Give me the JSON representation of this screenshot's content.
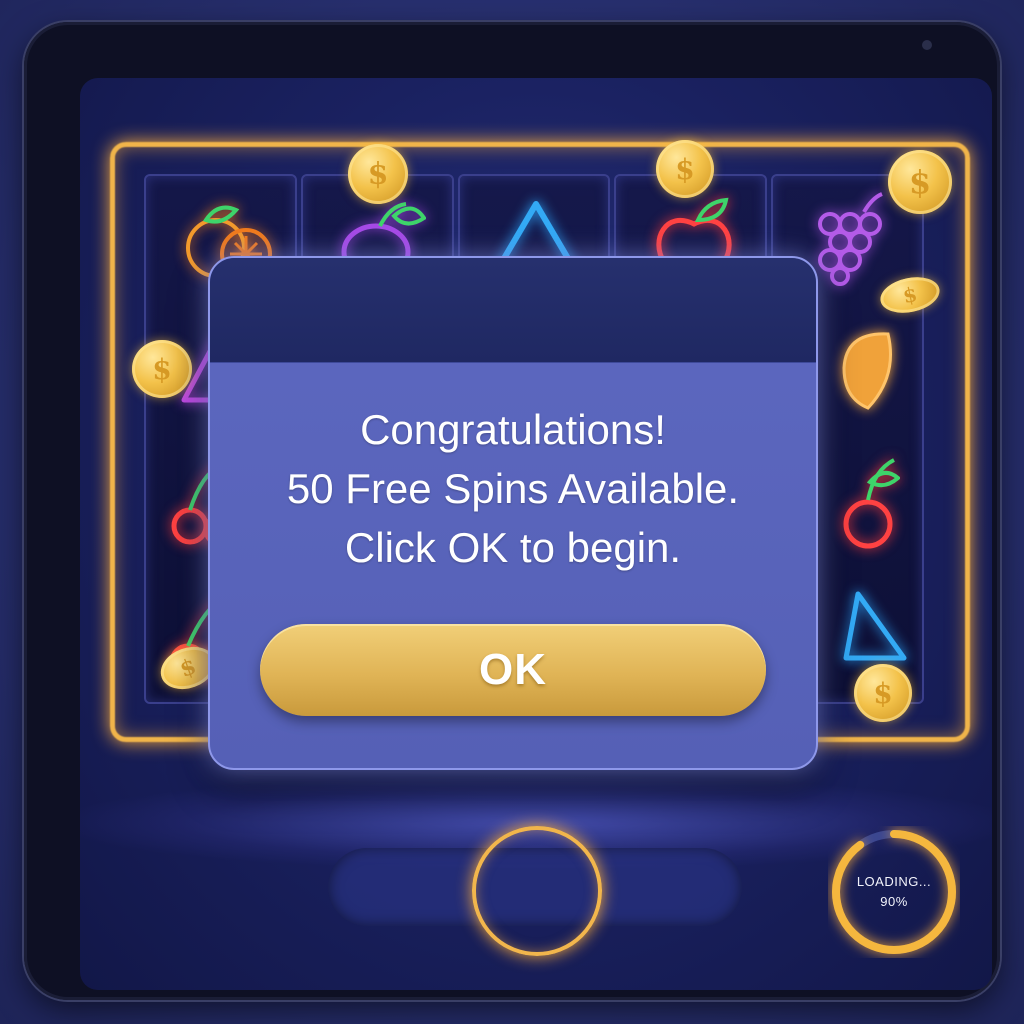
{
  "dialog": {
    "message_lines": [
      "Congratulations!",
      "50 Free Spins Available.",
      "Click OK to begin."
    ],
    "ok_label": "OK"
  },
  "loader": {
    "label": "LOADING...",
    "percent_text": "90%",
    "progress": 0.9
  },
  "coins": {
    "symbol": "$"
  },
  "colors": {
    "accent_gold": "#f2b64c",
    "dialog_body": "#5a65bb",
    "dialog_header": "#222b66",
    "button_gold": "#e0b456"
  },
  "reel_symbols": [
    "orange-icon",
    "plum-icon",
    "triangle-icon",
    "apple-icon",
    "grapes-icon",
    "triangle-icon",
    "lemon-icon",
    "cherry-icon",
    "cherry-icon",
    "triangle-icon"
  ]
}
